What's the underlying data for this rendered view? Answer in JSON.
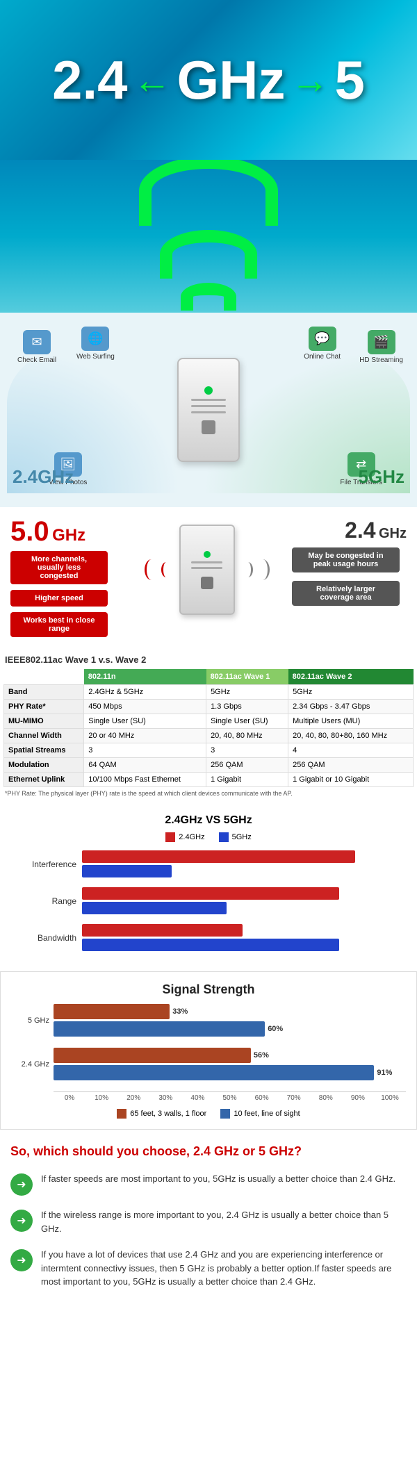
{
  "hero": {
    "freq_left": "2.4",
    "freq_right": "5",
    "arrow_left": "←",
    "arrow_right": "→",
    "unit": "GHz"
  },
  "band_diagram": {
    "left_band": "2.4GHz",
    "right_band": "5GHz",
    "icons": [
      {
        "label": "Check Email",
        "icon": "✉",
        "color": "blue",
        "pos": "top-left"
      },
      {
        "label": "Web Surfing",
        "icon": "🌐",
        "color": "blue",
        "pos": "top-center-left"
      },
      {
        "label": "Online Chat",
        "icon": "💬",
        "color": "green",
        "pos": "top-center-right"
      },
      {
        "label": "HD Streaming",
        "icon": "🎬",
        "color": "green",
        "pos": "top-right"
      },
      {
        "label": "View Photos",
        "icon": "🖼",
        "color": "blue",
        "pos": "mid-left"
      },
      {
        "label": "File Transfers",
        "icon": "⇄",
        "color": "green",
        "pos": "mid-right"
      }
    ]
  },
  "comparison": {
    "left_freq": "5.0",
    "left_unit": "GHz",
    "btn1": "More channels, usually less congested",
    "btn2": "Higher speed",
    "btn3": "Works best in close range",
    "right_freq": "2.4",
    "right_unit": "GHz",
    "right_btn1": "May be congested in peak usage hours",
    "right_btn2": "Relatively larger coverage area"
  },
  "table": {
    "title": "IEEE802.11ac Wave 1 v.s. Wave 2",
    "headers": [
      "",
      "802.11n",
      "802.11ac Wave 1",
      "802.11ac Wave 2"
    ],
    "rows": [
      {
        "label": "Band",
        "col1": "2.4GHz & 5GHz",
        "col2": "5GHz",
        "col3": "5GHz"
      },
      {
        "label": "PHY Rate*",
        "col1": "450 Mbps",
        "col2": "1.3 Gbps",
        "col3": "2.34 Gbps - 3.47 Gbps"
      },
      {
        "label": "MU-MIMO",
        "col1": "Single User (SU)",
        "col2": "Single User (SU)",
        "col3": "Multiple Users (MU)"
      },
      {
        "label": "Channel Width",
        "col1": "20 or 40 MHz",
        "col2": "20, 40, 80 MHz",
        "col3": "20, 40, 80, 80+80, 160 MHz"
      },
      {
        "label": "Spatial Streams",
        "col1": "3",
        "col2": "3",
        "col3": "4"
      },
      {
        "label": "Modulation",
        "col1": "64 QAM",
        "col2": "256 QAM",
        "col3": "256 QAM"
      },
      {
        "label": "Ethernet Uplink",
        "col1": "10/100 Mbps Fast Ethernet",
        "col2": "1 Gigabit",
        "col3": "1 Gigabit or 10 Gigabit"
      }
    ],
    "note": "*PHY Rate: The physical layer (PHY) rate is the speed at which client devices communicate with the AP."
  },
  "bar_chart": {
    "title": "2.4GHz VS 5GHz",
    "legend": [
      {
        "label": "2.4GHz",
        "color": "#cc2222"
      },
      {
        "label": "5GHz",
        "color": "#2244cc"
      }
    ],
    "bars": [
      {
        "label": "Interference",
        "red_pct": 85,
        "blue_pct": 28
      },
      {
        "label": "Range",
        "red_pct": 80,
        "blue_pct": 45
      },
      {
        "label": "Bandwidth",
        "red_pct": 50,
        "blue_pct": 80
      }
    ]
  },
  "signal_chart": {
    "title": "Signal Strength",
    "y_labels": [
      "5 GHz",
      "2.4 GHz"
    ],
    "groups": [
      {
        "label": "5 GHz",
        "bar1": {
          "pct": 33,
          "val": "33%",
          "color": "#aa4422"
        },
        "bar2": {
          "pct": 60,
          "val": "60%",
          "color": "#3366aa"
        }
      },
      {
        "label": "2.4 GHz",
        "bar1": {
          "pct": 56,
          "val": "56%",
          "color": "#aa4422"
        },
        "bar2": {
          "pct": 91,
          "val": "91%",
          "color": "#3366aa"
        }
      }
    ],
    "x_axis": [
      "0%",
      "10%",
      "20%",
      "30%",
      "40%",
      "50%",
      "60%",
      "70%",
      "80%",
      "90%",
      "100%"
    ],
    "legend": [
      {
        "label": "65 feet, 3 walls, 1 floor",
        "color": "#aa4422"
      },
      {
        "label": "10 feet, line of sight",
        "color": "#3366aa"
      }
    ]
  },
  "conclusion": {
    "title": "So, which should you choose, 2.4 GHz or 5 GHz?",
    "items": [
      "If faster speeds are most important to you, 5GHz is usually a better choice than 2.4 GHz.",
      "If the wireless range is more important to you, 2.4 GHz is usually a better choice than 5 GHz.",
      "If you have a lot of devices that use 2.4 GHz and you are experiencing interference or intermtent connectivy issues, then 5 GHz is probably a better option.If faster speeds are most important to you, 5GHz is usually a better choice than 2.4 GHz."
    ]
  }
}
